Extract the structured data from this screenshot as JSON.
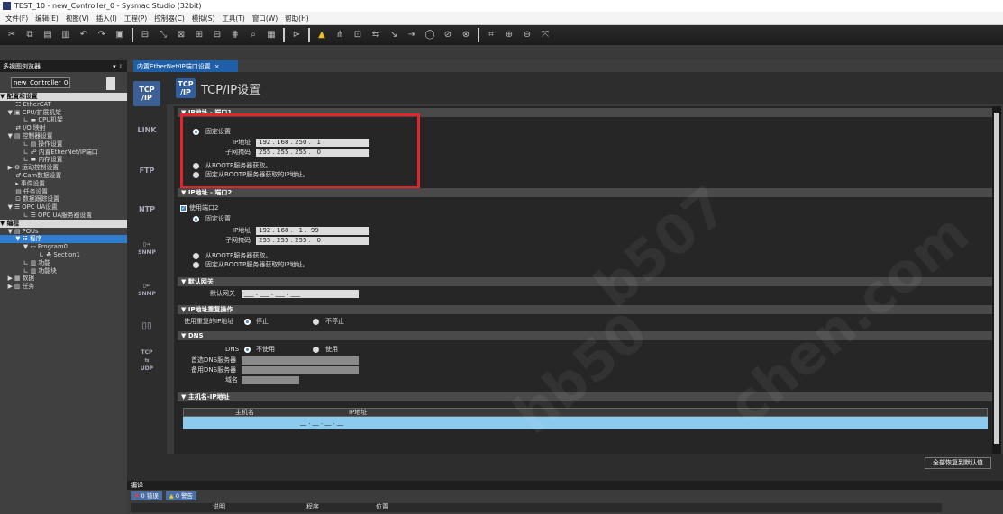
{
  "window": {
    "title": "TEST_10 - new_Controller_0 - Sysmac Studio (32bit)"
  },
  "menu": [
    "文件(F)",
    "编辑(E)",
    "视图(V)",
    "插入(I)",
    "工程(P)",
    "控制器(C)",
    "模拟(S)",
    "工具(T)",
    "窗口(W)",
    "帮助(H)"
  ],
  "toolbar_icons": [
    "cut-icon",
    "copy-icon",
    "paste-icon",
    "delete-icon",
    "undo-icon",
    "redo-icon",
    "save-icon",
    "sep",
    "transfer-icon",
    "cross-ref-icon",
    "search-icon",
    "replace-icon",
    "monitor-icon",
    "compare-icon",
    "sep",
    "online-icon",
    "sep",
    "warning-icon",
    "network-icon",
    "io-icon",
    "sync-icon",
    "step-icon",
    "forward-icon",
    "stop-icon",
    "break-icon",
    "watch-icon",
    "sep",
    "grid-icon",
    "zoom-in-icon",
    "zoom-out-icon",
    "fit-icon"
  ],
  "left_panel": {
    "title": "多视图浏览器",
    "controller": "new_Controller_0",
    "tree": [
      {
        "label": "▼ 配置和设置",
        "type": "sect"
      },
      {
        "label": "        ☷ EtherCAT",
        "type": "item"
      },
      {
        "label": "    ▼ ▣ CPU/扩展机架",
        "type": "item"
      },
      {
        "label": "            ∟ ▬ CPU机架",
        "type": "item"
      },
      {
        "label": "        ⇄ I/O 映射",
        "type": "item"
      },
      {
        "label": "    ▼ ▤ 控制器设置",
        "type": "item"
      },
      {
        "label": "            ∟ ▤ 操作设置",
        "type": "item"
      },
      {
        "label": "            ∟ ☍ 内置EtherNet/IP端口",
        "type": "item"
      },
      {
        "label": "            ∟ ▬ 内存设置",
        "type": "item"
      },
      {
        "label": "    ▶ ⚙ 运动控制设置",
        "type": "item"
      },
      {
        "label": "        ♂ Cam数据设置",
        "type": "item"
      },
      {
        "label": "        ▸ 事件设置",
        "type": "item"
      },
      {
        "label": "        ▤ 任务设置",
        "type": "item"
      },
      {
        "label": "        ⊡ 数据跟踪设置",
        "type": "item"
      },
      {
        "label": "    ▼ ☰ OPC UA设置",
        "type": "item"
      },
      {
        "label": "            ∟ ☰ OPC UA服务器设置",
        "type": "item"
      },
      {
        "label": "▼ 编程",
        "type": "sect"
      },
      {
        "label": "    ▼ ▤ POUs",
        "type": "item"
      },
      {
        "label": "        ▼ ☷ 程序",
        "type": "sel"
      },
      {
        "label": "            ▼ ▭ Program0",
        "type": "item"
      },
      {
        "label": "                    ∟ ☘ Section1",
        "type": "item"
      },
      {
        "label": "            ∟ ▥ 功能",
        "type": "item"
      },
      {
        "label": "            ∟ ▥ 功能块",
        "type": "item"
      },
      {
        "label": "    ▶ ▦ 数据",
        "type": "item"
      },
      {
        "label": "    ▶ ▥ 任务",
        "type": "item"
      }
    ]
  },
  "tab": {
    "label": "内置EtherNet/IP端口设置"
  },
  "nav_buttons": [
    "TCP\n/IP",
    "LINK",
    "FTP",
    "NTP",
    "▯→\nSNMP",
    "▯←\nSNMP",
    "▯▯",
    "TCP\n⇆\nUDP"
  ],
  "header": {
    "badge": "TCP\n/IP",
    "title": "TCP/IP设置"
  },
  "sections": {
    "port1": {
      "title": "▼ IP地址 - 端口1",
      "fixed": "固定设置",
      "ip_label": "IP地址",
      "ip": "192 . 168 . 250 .   1",
      "mask_label": "子网掩码",
      "mask": "255 . 255 . 255 .   0",
      "bootp": "从BOOTP服务器获取。",
      "bootp_fixed": "固定从BOOTP服务器获取的IP地址。"
    },
    "port2": {
      "title": "▼ IP地址 - 端口2",
      "use_port": "使用端口2",
      "fixed": "固定设置",
      "ip_label": "IP地址",
      "ip": "192 . 168 .   1 .  99",
      "mask_label": "子网掩码",
      "mask": "255 . 255 . 255 .   0",
      "bootp": "从BOOTP服务器获取。",
      "bootp_fixed": "固定从BOOTP服务器获取的IP地址。"
    },
    "gateway": {
      "title": "▼ 默认网关",
      "label": "默认网关",
      "value": "___ . ___ . ___ . ___"
    },
    "dup": {
      "title": "▼ IP地址重复操作",
      "label": "使用重复的IP地址",
      "stop": "停止",
      "nostop": "不停止"
    },
    "dns": {
      "title": "▼ DNS",
      "label": "DNS",
      "unused": "不使用",
      "used": "使用",
      "primary": "首选DNS服务器",
      "secondary": "备用DNS服务器",
      "domain": "域名"
    },
    "hosts": {
      "title": "▼ 主机名-IP地址",
      "col_host": "主机名",
      "col_ip": "IP地址",
      "row_ip": "__ . __ . __ . __"
    }
  },
  "reset_button": "全部恢复到默认值",
  "build": {
    "title": "编译",
    "errors": "0 错误",
    "warnings": "0 警告",
    "cols": [
      "说明",
      "程序",
      "位置"
    ]
  },
  "watermarks": [
    "hb50",
    "chen.com",
    "b507"
  ]
}
